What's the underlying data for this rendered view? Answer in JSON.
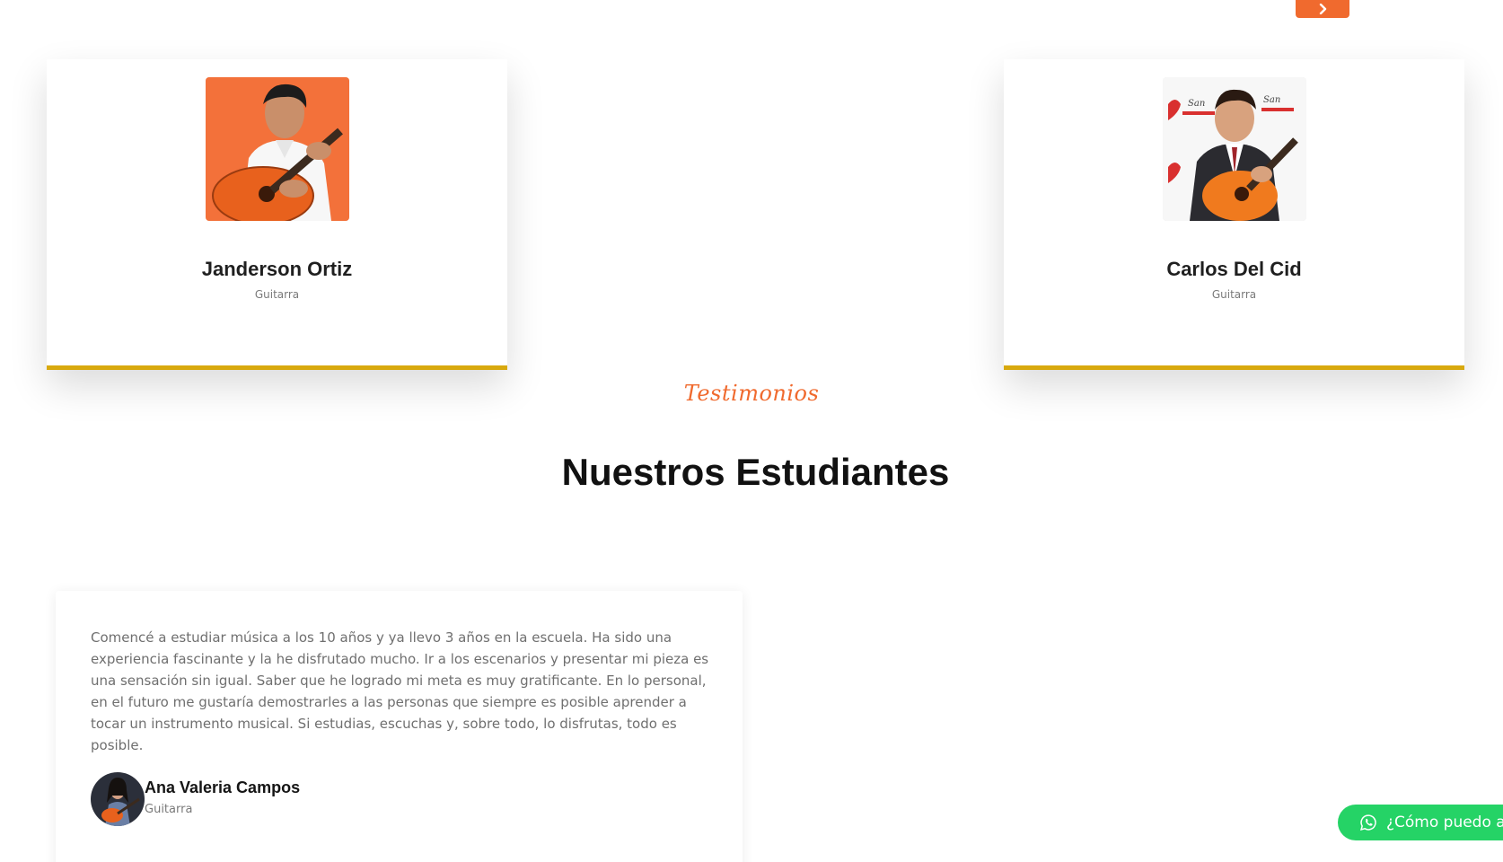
{
  "carousel": {
    "next_icon": "chevron-right-icon",
    "accent_color": "#f06a2e"
  },
  "teachers": [
    {
      "name": "Janderson Ortiz",
      "instrument": "Guitarra",
      "photo_bg": "#f26b35"
    },
    {
      "name": "Carlos Del Cid",
      "instrument": "Guitarra",
      "photo_bg": "#e9e9e9"
    }
  ],
  "card_border_color": "#d8a90e",
  "testimonials_section": {
    "eyebrow": "Testimonios",
    "title": "Nuestros Estudiantes"
  },
  "testimonial": {
    "text": "Comencé a estudiar música a los 10 años y ya llevo 3 años en la escuela. Ha sido una experiencia fascinante y la he disfrutado mucho. Ir a los escenarios y presentar mi pieza es una sensación sin igual. Saber que he logrado mi meta es muy gratificante. En lo personal, en el futuro me gustaría demostrarles a las personas que siempre es posible aprender a tocar un instrumento musical. Si estudias, escuchas y, sobre todo, lo disfrutas, todo es posible.",
    "student_name": "Ana Valeria Campos",
    "student_instrument": "Guitarra"
  },
  "whatsapp": {
    "label": "¿Cómo puedo a",
    "icon": "whatsapp-icon",
    "color": "#25d366"
  }
}
